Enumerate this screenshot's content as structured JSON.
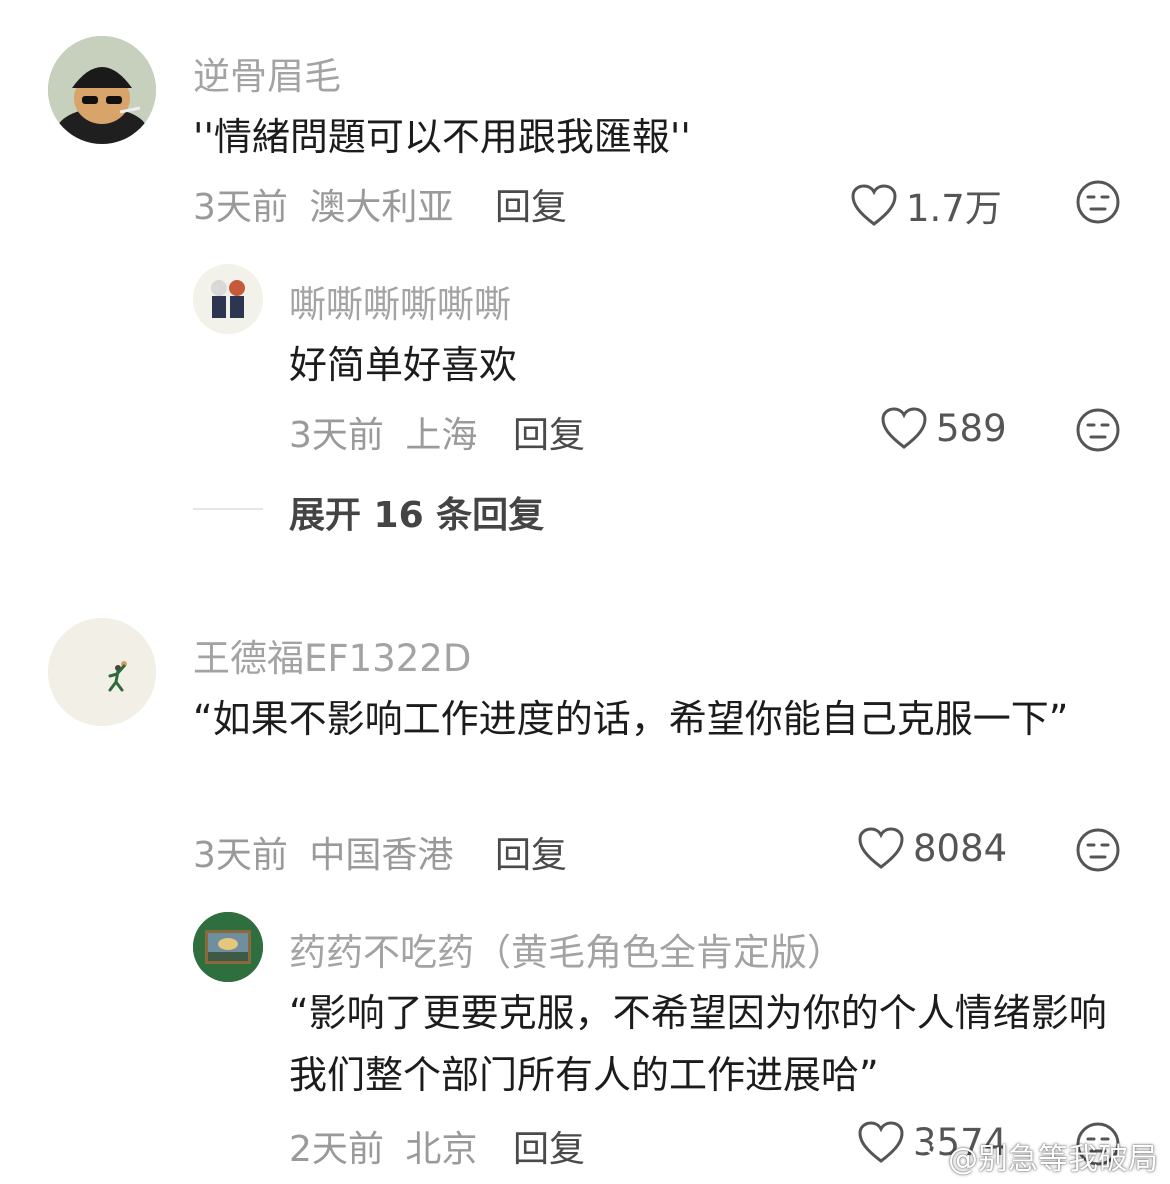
{
  "comments": [
    {
      "username": "逆骨眉毛",
      "text": "''情緒問題可以不用跟我匯報''",
      "time": "3天前",
      "location": "澳大利亚",
      "reply_label": "回复",
      "likes": "1.7万",
      "replies": [
        {
          "username": "嘶嘶嘶嘶嘶嘶",
          "text": "好简单好喜欢",
          "time": "3天前",
          "location": "上海",
          "reply_label": "回复",
          "likes": "589"
        }
      ],
      "expand_label": "展开 16 条回复"
    },
    {
      "username": "王德福EF1322D",
      "text": "“如果不影响工作进度的话，希望你能自己克服一下”",
      "time": "3天前",
      "location": "中国香港",
      "reply_label": "回复",
      "likes": "8084",
      "replies": [
        {
          "username": "药药不吃药（黄毛角色全肯定版）",
          "text": "“影响了更要克服，不希望因为你的个人情绪影响我们整个部门所有人的工作进展哈”",
          "time": "2天前",
          "location": "北京",
          "reply_label": "回复",
          "likes": "3574"
        }
      ]
    }
  ],
  "watermark": "@别急等我破局",
  "colors": {
    "username": "#a3a3a3",
    "text": "#1c1c1c",
    "meta": "#9a9a9a",
    "icon": "#555555"
  }
}
